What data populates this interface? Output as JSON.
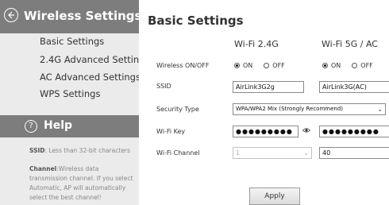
{
  "sidebar": {
    "title": "Wireless Settings",
    "menu": [
      {
        "label": "Basic Settings"
      },
      {
        "label": "2.4G Advanced Settings"
      },
      {
        "label": "AC Advanced Settings"
      },
      {
        "label": "WPS Settings"
      }
    ],
    "help": {
      "title": "Help",
      "icon": "?",
      "ssid_term": "SSID",
      "ssid_text": ": Less than 32-bit characters",
      "channel_term": "Channel",
      "channel_lines": [
        ":Wireless data",
        "transmission channel. If you select",
        "Automatic, AP will automatically",
        "select the best channel!"
      ]
    }
  },
  "main": {
    "title": "Basic Settings",
    "columns": {
      "wifi24": "Wi-Fi 2.4G",
      "wifi5": "Wi-Fi 5G / AC"
    },
    "labels": {
      "onoff": "Wireless ON/OFF",
      "ssid": "SSID",
      "security": "Security Type",
      "key": "Wi-Fi Key",
      "channel": "Wi-Fi Channel"
    },
    "radio": {
      "on": "ON",
      "off": "OFF",
      "wifi24_selected": "ON",
      "wifi5_selected": "ON"
    },
    "ssid_24": "AirLink3G2g",
    "ssid_5": "AirLink3G(AC)",
    "security_24": "WPA/WPA2 Mix (Strongly Recommend)",
    "key_24": "●●●●●●●●●",
    "key_5": "●●●●●●●●●",
    "channel_24": "1",
    "channel_5": "40",
    "apply": "Apply"
  },
  "icons": {
    "back": "circle-arrow-left-icon",
    "help": "question-circle-icon",
    "reveal": "eye-icon",
    "dropdown": "chevron-down-icon"
  }
}
